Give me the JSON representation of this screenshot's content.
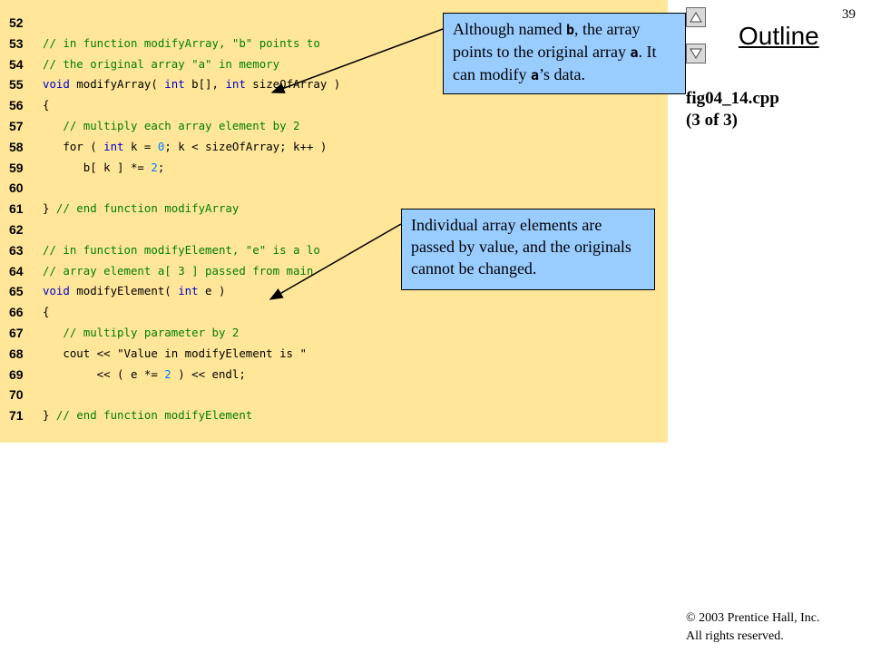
{
  "page_number": "39",
  "outline": {
    "title": "Outline",
    "prev_label": "▲",
    "next_label": "▼"
  },
  "file": {
    "name": "fig04_14.cpp",
    "part": "(3 of 3)"
  },
  "copyright": "© 2003 Prentice Hall, Inc.",
  "rights": "All rights reserved.",
  "code_lines": [
    {
      "n": "52",
      "segs": []
    },
    {
      "n": "53",
      "segs": [
        {
          "t": "// in function modifyArray, \"b\" points to",
          "c": "comment"
        }
      ]
    },
    {
      "n": "54",
      "segs": [
        {
          "t": "// the original array \"a\" in memory",
          "c": "comment"
        }
      ]
    },
    {
      "n": "55",
      "segs": [
        {
          "t": "void",
          "c": "kw"
        },
        {
          "t": " modifyArray( ",
          "c": ""
        },
        {
          "t": "int",
          "c": "kw"
        },
        {
          "t": " b[], ",
          "c": ""
        },
        {
          "t": "int",
          "c": "kw"
        },
        {
          "t": " sizeOfArray )",
          "c": ""
        }
      ]
    },
    {
      "n": "56",
      "segs": [
        {
          "t": "{",
          "c": ""
        }
      ]
    },
    {
      "n": "57",
      "segs": [
        {
          "t": "   // multiply each array element by 2",
          "c": "comment"
        }
      ]
    },
    {
      "n": "58",
      "segs": [
        {
          "t": "   for ( ",
          "c": ""
        },
        {
          "t": "int",
          "c": "kw"
        },
        {
          "t": " k = ",
          "c": ""
        },
        {
          "t": "0",
          "c": "num"
        },
        {
          "t": "; k < sizeOfArray; k++ )",
          "c": ""
        }
      ]
    },
    {
      "n": "59",
      "segs": [
        {
          "t": "      b[ k ] *= ",
          "c": ""
        },
        {
          "t": "2",
          "c": "num"
        },
        {
          "t": ";",
          "c": ""
        }
      ]
    },
    {
      "n": "60",
      "segs": []
    },
    {
      "n": "61",
      "segs": [
        {
          "t": "} ",
          "c": ""
        },
        {
          "t": "// end function modifyArray",
          "c": "comment"
        }
      ]
    },
    {
      "n": "62",
      "segs": []
    },
    {
      "n": "63",
      "segs": [
        {
          "t": "// in function modifyElement, \"e\" is a lo",
          "c": "comment"
        }
      ]
    },
    {
      "n": "64",
      "segs": [
        {
          "t": "// array element a[ 3 ] passed from main",
          "c": "comment"
        }
      ]
    },
    {
      "n": "65",
      "segs": [
        {
          "t": "void",
          "c": "kw"
        },
        {
          "t": " modifyElement( ",
          "c": ""
        },
        {
          "t": "int",
          "c": "kw"
        },
        {
          "t": " e )",
          "c": ""
        }
      ]
    },
    {
      "n": "66",
      "segs": [
        {
          "t": "{",
          "c": ""
        }
      ]
    },
    {
      "n": "67",
      "segs": [
        {
          "t": "   // multiply parameter by 2",
          "c": "comment"
        }
      ]
    },
    {
      "n": "68",
      "segs": [
        {
          "t": "   cout << ",
          "c": ""
        },
        {
          "t": "\"Value in modifyElement is \"",
          "c": "str"
        }
      ]
    },
    {
      "n": "69",
      "segs": [
        {
          "t": "        << ( e *= ",
          "c": ""
        },
        {
          "t": "2",
          "c": "num"
        },
        {
          "t": " ) << endl;",
          "c": ""
        }
      ]
    },
    {
      "n": "70",
      "segs": []
    },
    {
      "n": "71",
      "segs": [
        {
          "t": "} ",
          "c": ""
        },
        {
          "t": "// end function modifyElement",
          "c": "comment"
        }
      ]
    }
  ],
  "callout1": {
    "p1": "Although named ",
    "m1": "b",
    "p2": ", the array points to the original array ",
    "m2": "a",
    "p3": ". It can modify ",
    "m3": "a",
    "p4": "’s data."
  },
  "callout2": {
    "text": "Individual array elements are passed by value, and the originals cannot be changed."
  }
}
